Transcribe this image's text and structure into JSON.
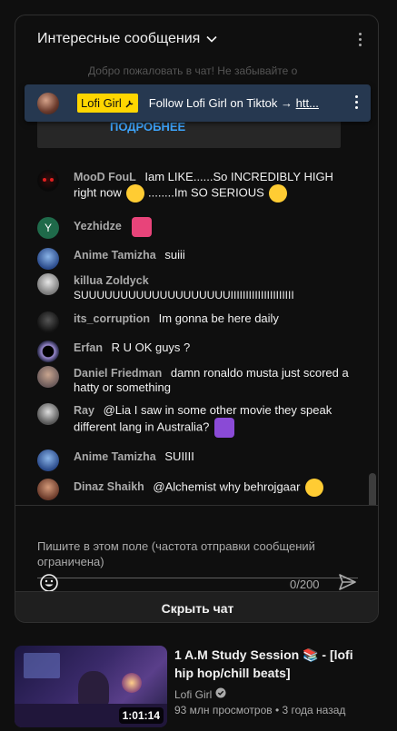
{
  "chat": {
    "title": "Интересные сообщения",
    "welcome_ghost": "Добро пожаловать в чат! Не забывайте о",
    "welcome_more": "ПОДРОБНЕЕ",
    "pinned": {
      "author": "Lofi Girl",
      "text": "Follow Lofi Girl on Tiktok → ",
      "link": "htt..."
    },
    "messages": [
      {
        "author": "MooD FouL",
        "text": "Iam LIKE......So INCREDIBLY HIGH right now",
        "text2": "........Im SO SERIOUS"
      },
      {
        "author": "Yezhidze",
        "avatar_letter": "Y",
        "text": ""
      },
      {
        "author": "Anime Tamizha",
        "text": "suiii"
      },
      {
        "author": "killua Zoldyck",
        "text": "SUUUUUUUUUUUUUUUUUUUIIIIIIIIIIIIIIIIIIIII"
      },
      {
        "author": "its_corruption",
        "text": "Im gonna be here daily"
      },
      {
        "author": "Erfan",
        "text": "R U OK guys ?"
      },
      {
        "author": "Daniel Friedman",
        "text": "damn ronaldo musta just scored a hatty or something"
      },
      {
        "author": "Ray",
        "text": "@Lia I saw in some other movie they speak different lang in Australia?"
      },
      {
        "author": "Anime Tamizha",
        "text": "SUIIII"
      },
      {
        "author": "Dinaz Shaikh",
        "text": "@Alchemist why behrojgaar"
      }
    ],
    "input_placeholder": "Пишите в этом поле (частота отправки сообщений ограничена)",
    "counter": "0/200",
    "hide_chat": "Скрыть чат"
  },
  "video": {
    "title": "1 A.M Study Session 📚 - [lofi hip hop/chill beats]",
    "channel": "Lofi Girl",
    "views": "93 млн просмотров",
    "age": "3 года назад",
    "duration": "1:01:14"
  },
  "colors": {
    "background": "#0f0f0f",
    "panel": "#1f1f1f",
    "pinned_banner": "#263850",
    "owner_badge": "#ffd600",
    "link_blue": "#3ea6ff"
  }
}
